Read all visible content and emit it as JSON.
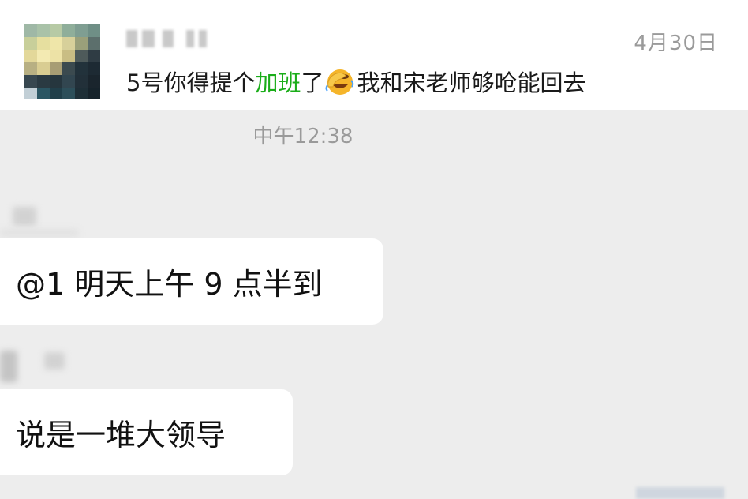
{
  "preview": {
    "date": "4月30日",
    "message_before": "5号你得提个",
    "message_highlight": "加班",
    "message_mid": "了",
    "emoji": "facepalm-laugh-emoji",
    "message_after": "我和宋老师够呛能回去",
    "highlight_color": "#1aad19"
  },
  "chat": {
    "time_separator": "中午12:38",
    "messages": [
      {
        "text": "@1 明天上午 9 点半到"
      },
      {
        "text": "说是一堆大领导"
      }
    ]
  },
  "colors": {
    "background": "#ededed",
    "bubble": "#ffffff",
    "meta_text": "#9a9a9a"
  }
}
